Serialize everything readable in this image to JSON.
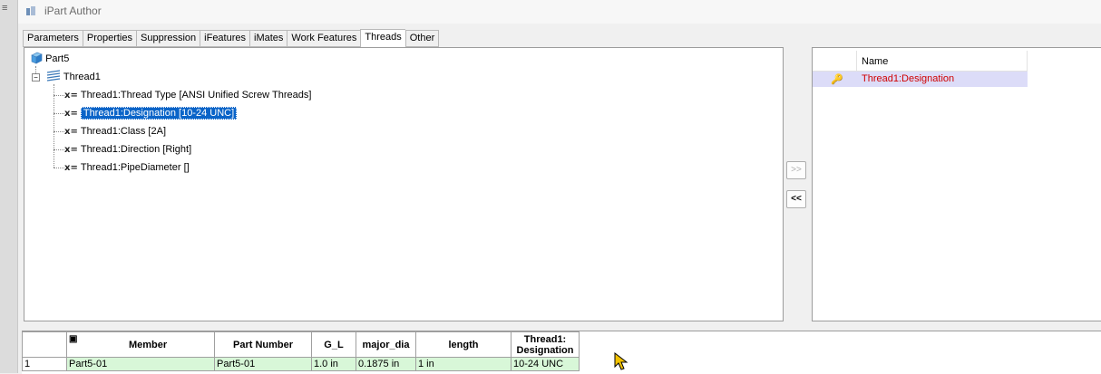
{
  "window": {
    "title": "iPart Author"
  },
  "tabs": [
    "Parameters",
    "Properties",
    "Suppression",
    "iFeatures",
    "iMates",
    "Work Features",
    "Threads",
    "Other"
  ],
  "active_tab": "Threads",
  "tree": {
    "root": "Part5",
    "feature": "Thread1",
    "items": [
      "Thread1:Thread Type [ANSI Unified Screw Threads]",
      "Thread1:Designation [10-24 UNC]",
      "Thread1:Class [2A]",
      "Thread1:Direction [Right]",
      "Thread1:PipeDiameter []"
    ],
    "param_symbol": "x="
  },
  "buttons": {
    "add": ">>",
    "remove": "<<"
  },
  "name_list": {
    "header": "Name",
    "rows": [
      "Thread1:Designation"
    ]
  },
  "grid": {
    "headers": [
      "Member",
      "Part Number",
      "G_L",
      "major_dia",
      "length"
    ],
    "header_thread_line1": "Thread1:",
    "header_thread_line2": "Designation",
    "row": {
      "num": "1",
      "member": "Part5-01",
      "part_number": "Part5-01",
      "g_l": "1.0 in",
      "major_dia": "0.1875 in",
      "length": "1 in",
      "designation": "10-24 UNC"
    }
  },
  "colors": {
    "selection": "#0a64c8",
    "name_text": "#d00000",
    "row_bg": "#d8f7d8",
    "name_row_bg": "#dcdcf8"
  }
}
